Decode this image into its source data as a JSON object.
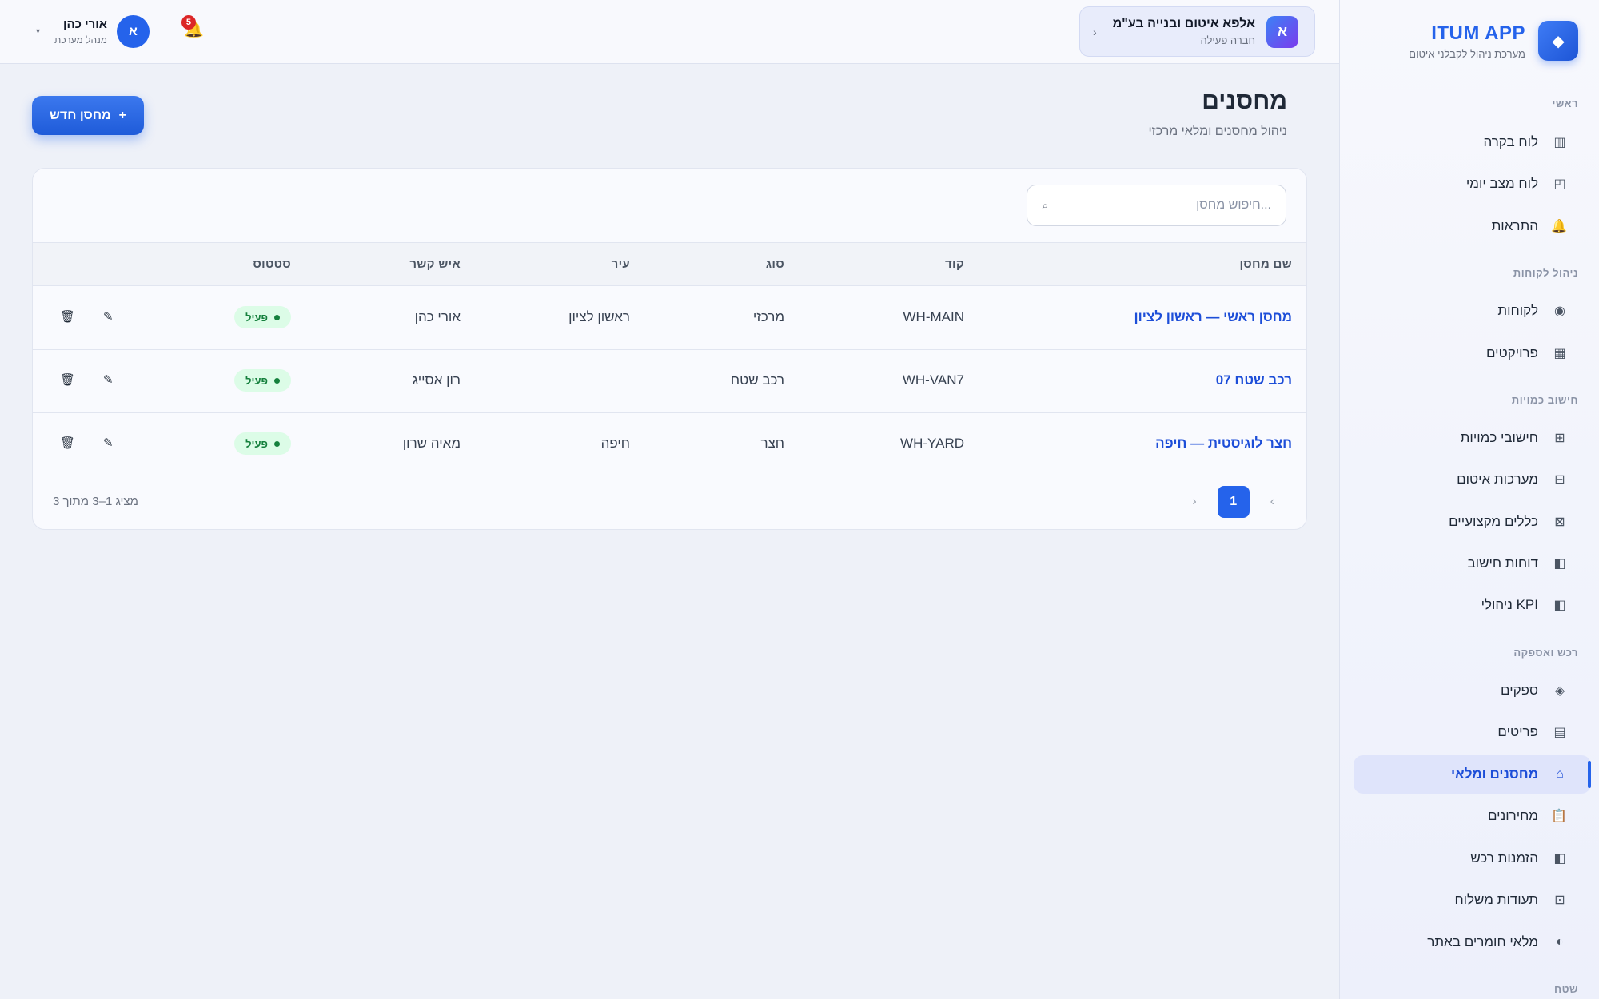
{
  "brand": {
    "name": "ITUM APP",
    "subtitle": "מערכת ניהול לקבלני איטום",
    "logo_icon": "◆"
  },
  "sidebar": {
    "sections": [
      "ראשי",
      "ניהול לקוחות",
      "חישוב כמויות",
      "רכש ואספקה",
      "שטח"
    ],
    "items": [
      {
        "label": "לוח בקרה",
        "icon": "▥"
      },
      {
        "label": "לוח מצב יומי",
        "icon": "◰"
      },
      {
        "label": "התראות",
        "icon": "🔔"
      },
      {
        "label": "לקוחות",
        "icon": "◉"
      },
      {
        "label": "פרויקטים",
        "icon": "▦"
      },
      {
        "label": "חישובי כמויות",
        "icon": "⊞"
      },
      {
        "label": "מערכות איטום",
        "icon": "⊟"
      },
      {
        "label": "כללים מקצועיים",
        "icon": "⊠"
      },
      {
        "label": "דוחות חישוב",
        "icon": "◧"
      },
      {
        "label": "KPI ניהולי",
        "icon": "◧"
      },
      {
        "label": "ספקים",
        "icon": "◈"
      },
      {
        "label": "פריטים",
        "icon": "▤"
      },
      {
        "label": "מחסנים ומלאי",
        "icon": "⌂"
      },
      {
        "label": "מחירונים",
        "icon": "📋"
      },
      {
        "label": "הזמנות רכש",
        "icon": "◧"
      },
      {
        "label": "תעודות משלוח",
        "icon": "⊡"
      },
      {
        "label": "מלאי חומרים באתר",
        "icon": "◐"
      }
    ],
    "active_item": "מחסנים ומלאי"
  },
  "topbar": {
    "company": {
      "avatar": "א",
      "name": "אלפא איטום ובנייה בע\"מ",
      "status": "חברה פעילה",
      "chevron": "‹"
    },
    "notifications": {
      "count": "5",
      "icon": "🔔"
    },
    "user": {
      "avatar": "א",
      "name": "אורי כהן",
      "role": "מנהל מערכת",
      "caret": "▾"
    }
  },
  "page": {
    "title": "מחסנים",
    "subtitle": "ניהול מחסנים ומלאי מרכזי",
    "new_button": "מחסן חדש",
    "new_button_icon": "+"
  },
  "search": {
    "placeholder": "...חיפוש מחסן",
    "value": "",
    "icon": "⌕"
  },
  "table": {
    "columns": {
      "name": "שם מחסן",
      "code": "קוד",
      "type": "סוג",
      "city": "עיר",
      "contact": "איש קשר",
      "status": "סטטוס"
    },
    "rows": [
      {
        "name": "מחסן ראשי — ראשון לציון",
        "code": "WH-MAIN",
        "type": "מרכזי",
        "city": "ראשון לציון",
        "contact": "אורי כהן",
        "status": "פעיל"
      },
      {
        "name": "רכב שטח 07",
        "code": "WH-VAN7",
        "type": "רכב שטח",
        "city": "",
        "contact": "רון אסייג",
        "status": "פעיל"
      },
      {
        "name": "חצר לוגיסטית — חיפה",
        "code": "WH-YARD",
        "type": "חצר",
        "city": "חיפה",
        "contact": "מאיה שרון",
        "status": "פעיל"
      }
    ],
    "edit_icon": "✎",
    "delete_icon": "🗑"
  },
  "pagination": {
    "info": "מציג 1–3 מתוך 3",
    "current_page": "1",
    "prev": "‹",
    "next": "›"
  },
  "colors": {
    "accent": "#2563eb",
    "active_bg": "#dfe4fb",
    "status_bg": "#dcfce7",
    "status_text": "#15803d",
    "badge": "#dc2626"
  }
}
